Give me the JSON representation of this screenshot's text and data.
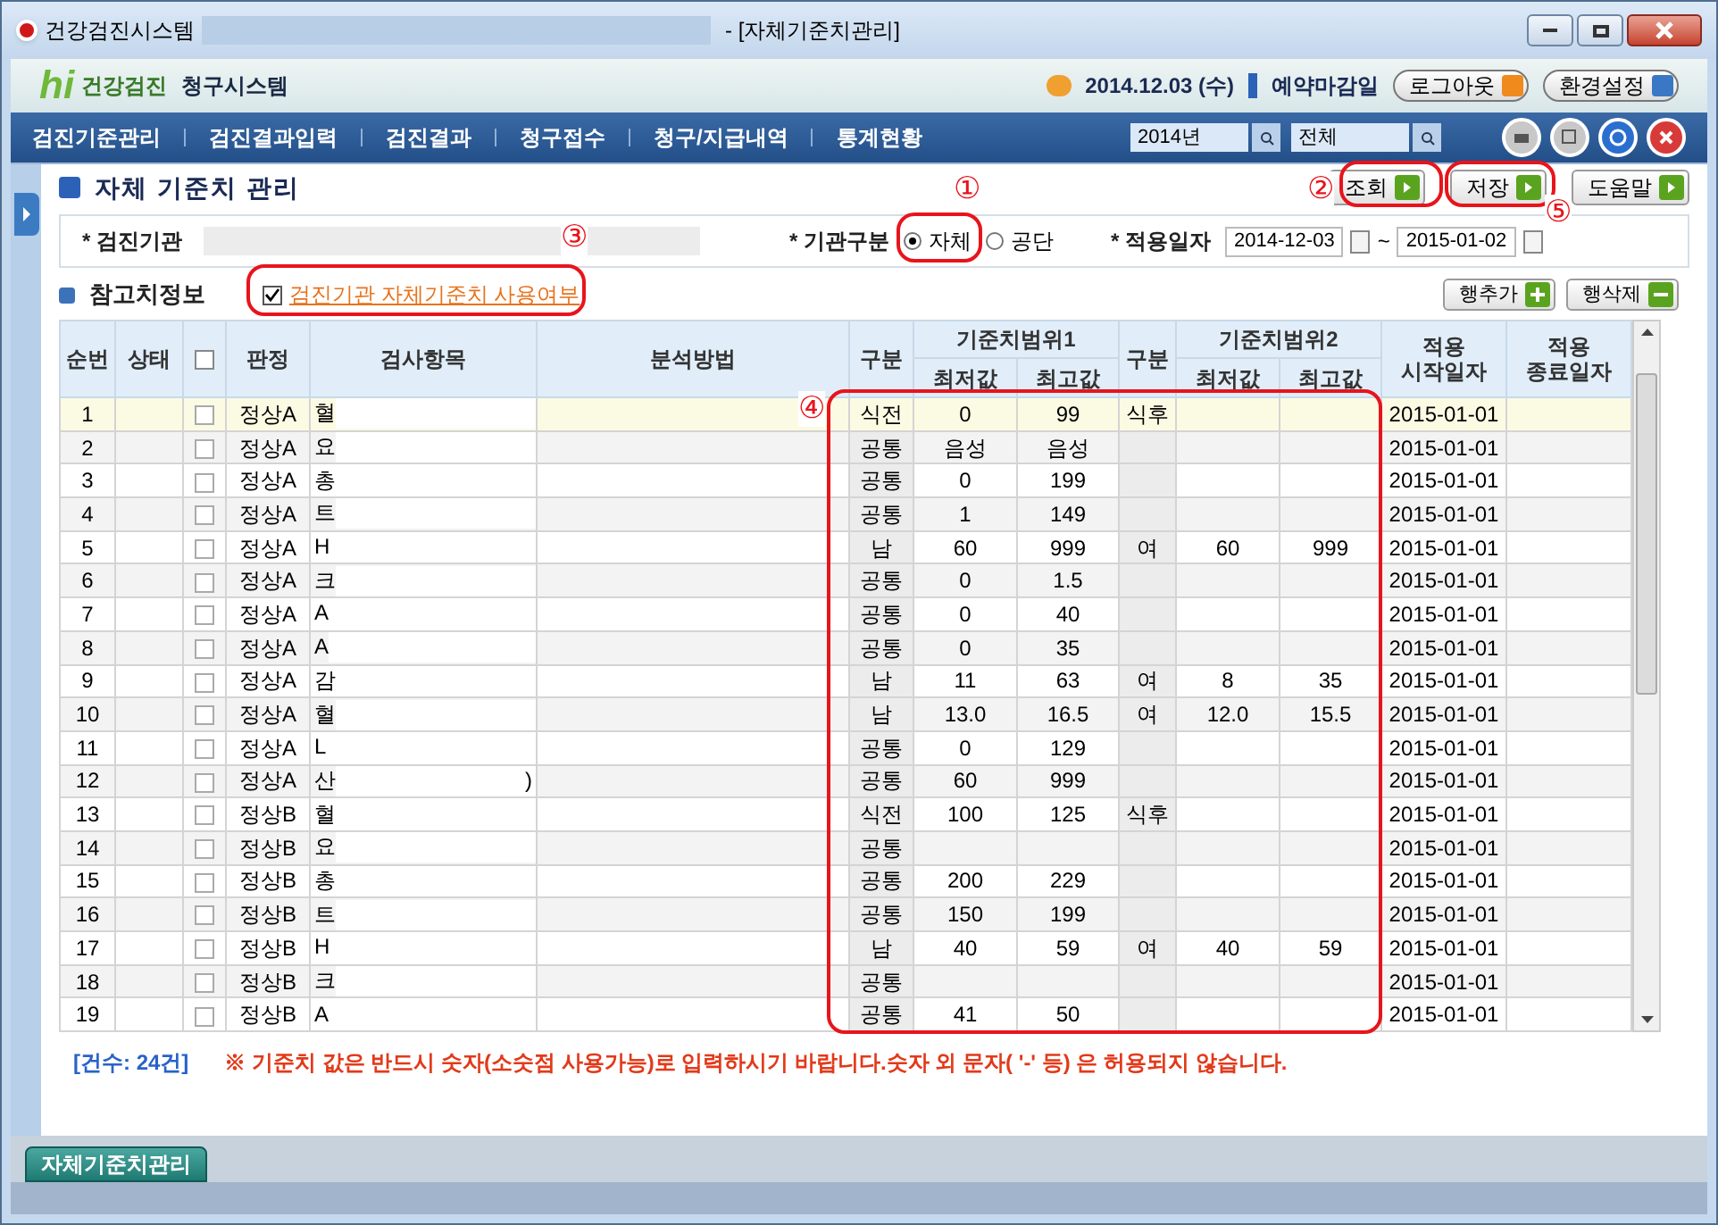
{
  "window": {
    "title": "건강검진시스템",
    "subtitle": "- [자체기준치관리]"
  },
  "header": {
    "logo_mark": "hi",
    "logo_text": "건강검진",
    "logo_sub": "청구시스템",
    "date": "2014.12.03 (수)",
    "deadline": "예약마감일",
    "buttons": [
      "로그아웃",
      "환경설정"
    ]
  },
  "nav": {
    "items": [
      "검진기준관리",
      "검진결과입력",
      "검진결과",
      "청구접수",
      "청구/지급내역",
      "통계현황"
    ],
    "year": "2014년",
    "scope": "전체"
  },
  "page": {
    "title": "자체 기준치 관리",
    "buttons": [
      "조회",
      "저장",
      "도움말"
    ]
  },
  "form": {
    "org_label": "* 검진기관",
    "type_label": "* 기관구분",
    "types": [
      {
        "label": "자체",
        "selected": true
      },
      {
        "label": "공단",
        "selected": false
      }
    ],
    "date_label": "* 적용일자",
    "date_from": "2014-12-03",
    "date_sep": "~",
    "date_to": "2015-01-02"
  },
  "section": {
    "title": "참고치정보",
    "use_label": "검진기관 자체기준치 사용여부",
    "use_checked": true,
    "buttons": [
      "행추가",
      "행삭제"
    ]
  },
  "table": {
    "all_checked": false,
    "columns": [
      "순번",
      "상태",
      "판정",
      "검사항목",
      "분석방법",
      "구분",
      "기준치범위1",
      "최저값",
      "최고값",
      "구분",
      "기준치범위2",
      "최저값",
      "최고값",
      "적용\n시작일자",
      "적용\n종료일자"
    ],
    "rows": [
      {
        "no": "1",
        "judgment": "정상A",
        "item": "혈",
        "g1": "식전",
        "min1": "0",
        "max1": "99",
        "g2": "식후",
        "min2": "",
        "max2": "",
        "start": "2015-01-01",
        "selected": true
      },
      {
        "no": "2",
        "judgment": "정상A",
        "item": "요",
        "g1": "공통",
        "min1": "음성",
        "max1": "음성",
        "g2": "",
        "min2": "",
        "max2": "",
        "start": "2015-01-01",
        "selected": false
      },
      {
        "no": "3",
        "judgment": "정상A",
        "item": "총",
        "g1": "공통",
        "min1": "0",
        "max1": "199",
        "g2": "",
        "min2": "",
        "max2": "",
        "start": "2015-01-01",
        "selected": false
      },
      {
        "no": "4",
        "judgment": "정상A",
        "item": "트",
        "g1": "공통",
        "min1": "1",
        "max1": "149",
        "g2": "",
        "min2": "",
        "max2": "",
        "start": "2015-01-01",
        "selected": false
      },
      {
        "no": "5",
        "judgment": "정상A",
        "item": "H",
        "g1": "남",
        "min1": "60",
        "max1": "999",
        "g2": "여",
        "min2": "60",
        "max2": "999",
        "start": "2015-01-01",
        "selected": false
      },
      {
        "no": "6",
        "judgment": "정상A",
        "item": "크",
        "g1": "공통",
        "min1": "0",
        "max1": "1.5",
        "g2": "",
        "min2": "",
        "max2": "",
        "start": "2015-01-01",
        "selected": false
      },
      {
        "no": "7",
        "judgment": "정상A",
        "item": "A",
        "g1": "공통",
        "min1": "0",
        "max1": "40",
        "g2": "",
        "min2": "",
        "max2": "",
        "start": "2015-01-01",
        "selected": false
      },
      {
        "no": "8",
        "judgment": "정상A",
        "item": "A",
        "g1": "공통",
        "min1": "0",
        "max1": "35",
        "g2": "",
        "min2": "",
        "max2": "",
        "start": "2015-01-01",
        "selected": false
      },
      {
        "no": "9",
        "judgment": "정상A",
        "item": "감",
        "g1": "남",
        "min1": "11",
        "max1": "63",
        "g2": "여",
        "min2": "8",
        "max2": "35",
        "start": "2015-01-01",
        "selected": false
      },
      {
        "no": "10",
        "judgment": "정상A",
        "item": "혈",
        "g1": "남",
        "min1": "13.0",
        "max1": "16.5",
        "g2": "여",
        "min2": "12.0",
        "max2": "15.5",
        "start": "2015-01-01",
        "selected": false
      },
      {
        "no": "11",
        "judgment": "정상A",
        "item": "L",
        "g1": "공통",
        "min1": "0",
        "max1": "129",
        "g2": "",
        "min2": "",
        "max2": "",
        "start": "2015-01-01",
        "selected": false
      },
      {
        "no": "12",
        "judgment": "정상A",
        "item": "산",
        "item_tail": ")",
        "g1": "공통",
        "min1": "60",
        "max1": "999",
        "g2": "",
        "min2": "",
        "max2": "",
        "start": "2015-01-01",
        "selected": false
      },
      {
        "no": "13",
        "judgment": "정상B",
        "item": "혈",
        "g1": "식전",
        "min1": "100",
        "max1": "125",
        "g2": "식후",
        "min2": "",
        "max2": "",
        "start": "2015-01-01",
        "selected": false
      },
      {
        "no": "14",
        "judgment": "정상B",
        "item": "요",
        "g1": "공통",
        "min1": "",
        "max1": "",
        "g2": "",
        "min2": "",
        "max2": "",
        "start": "2015-01-01",
        "selected": false
      },
      {
        "no": "15",
        "judgment": "정상B",
        "item": "총",
        "g1": "공통",
        "min1": "200",
        "max1": "229",
        "g2": "",
        "min2": "",
        "max2": "",
        "start": "2015-01-01",
        "selected": false
      },
      {
        "no": "16",
        "judgment": "정상B",
        "item": "트",
        "g1": "공통",
        "min1": "150",
        "max1": "199",
        "g2": "",
        "min2": "",
        "max2": "",
        "start": "2015-01-01",
        "selected": false
      },
      {
        "no": "17",
        "judgment": "정상B",
        "item": "H",
        "g1": "남",
        "min1": "40",
        "max1": "59",
        "g2": "여",
        "min2": "40",
        "max2": "59",
        "start": "2015-01-01",
        "selected": false
      },
      {
        "no": "18",
        "judgment": "정상B",
        "item": "크",
        "g1": "공통",
        "min1": "",
        "max1": "",
        "g2": "",
        "min2": "",
        "max2": "",
        "start": "2015-01-01",
        "selected": false
      },
      {
        "no": "19",
        "judgment": "정상B",
        "item": "A",
        "g1": "공통",
        "min1": "41",
        "max1": "50",
        "g2": "",
        "min2": "",
        "max2": "",
        "start": "2015-01-01",
        "selected": false
      }
    ]
  },
  "footer": {
    "count": "[건수: 24건]",
    "notice": "※ 기준치 값은 반드시 숫자(소숫점 사용가능)로 입력하시기 바랍니다.숫자 외 문자( '-' 등) 은 허용되지 않습니다."
  },
  "bottom_tab": "자체기준치관리",
  "annotations": [
    "①",
    "②",
    "③",
    "④",
    "⑤"
  ]
}
